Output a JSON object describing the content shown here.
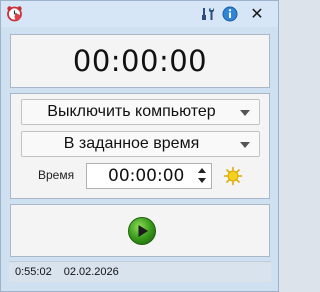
{
  "title_bar": {
    "app_icon": "alarm-clock-icon",
    "tools_icon": "tools-icon",
    "info_icon": "info-icon",
    "close_label": "✕"
  },
  "timer": {
    "display": "00:00:00"
  },
  "settings": {
    "action": "Выключить компьютер",
    "mode": "В заданное время",
    "time_label": "Время",
    "time_value": "00:00:00",
    "current_time_icon": "sun-icon"
  },
  "controls": {
    "start_icon": "play-icon"
  },
  "status_bar": {
    "time": "0:55:02",
    "date": "02.02.2026"
  },
  "colors": {
    "window_bg": "#cfe0f1",
    "panel_bg": "#f4f4f4",
    "play_green": "#3a9c1c",
    "sun_yellow": "#f2d21a",
    "info_blue": "#2f86d6"
  }
}
